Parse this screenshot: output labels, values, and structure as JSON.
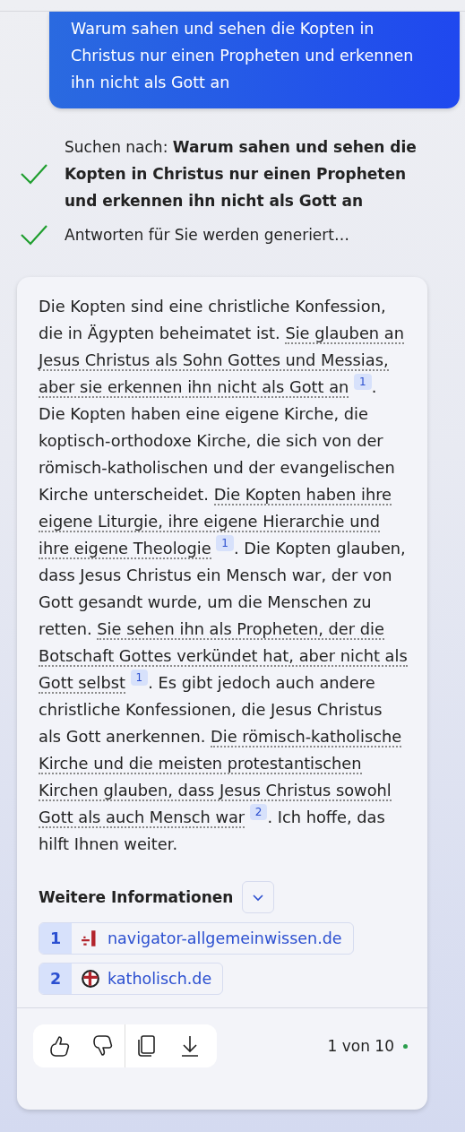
{
  "user_message": {
    "text": "Warum sahen und sehen die Kopten in Christus nur einen Propheten und erkennen ihn nicht als Gott an"
  },
  "steps": [
    {
      "kind": "check",
      "text": "Suchen nach: **Warum sahen und sehen die Kopten in Christus nur einen Propheten und erkennen ihn nicht als Gott an**"
    },
    {
      "kind": "check",
      "text": "Antworten für Sie werden generiert…"
    }
  ],
  "answer": {
    "segments": [
      {
        "kind": "plain",
        "text": "Die Kopten sind eine christliche Konfession, die in Ägypten beheimatet ist. "
      },
      {
        "kind": "cited",
        "text": "Sie glauben an Jesus Christus als Sohn Gottes und Messias, aber sie erkennen ihn nicht als Gott an",
        "ref": "1"
      },
      {
        "kind": "plain",
        "text": ". Die Kopten haben eine eigene Kirche, die koptisch-orthodoxe Kirche, die sich von der römisch-katholischen und der evangelischen Kirche unterscheidet. "
      },
      {
        "kind": "cited",
        "text": "Die Kopten haben ihre eigene Liturgie, ihre eigene Hierarchie und ihre eigene Theologie",
        "ref": "1"
      },
      {
        "kind": "plain",
        "text": ". Die Kopten glauben, dass Jesus Christus ein Mensch war, der von Gott gesandt wurde, um die Menschen zu retten. "
      },
      {
        "kind": "cited",
        "text": "Sie sehen ihn als Propheten, der die Botschaft Gottes verkündet hat, aber nicht als Gott selbst",
        "ref": "1"
      },
      {
        "kind": "plain",
        "text": ". Es gibt jedoch auch andere christliche Konfessionen, die Jesus Christus als Gott anerkennen. "
      },
      {
        "kind": "cited",
        "text": "Die römisch-katholische Kirche und die meisten protestantischen Kirchen glauben, dass Jesus Christus sowohl Gott als auch Mensch war",
        "ref": "2"
      },
      {
        "kind": "plain",
        "text": ". Ich hoffe, das hilft Ihnen weiter."
      }
    ],
    "more_info": {
      "label": "Weitere Informationen",
      "expanded": false
    },
    "sources": [
      {
        "number": "1",
        "kind": "navigator",
        "domain": "navigator-allgemeinwissen.de"
      },
      {
        "number": "2",
        "kind": "cross",
        "domain": "katholisch.de"
      }
    ],
    "actions": [
      {
        "kind": "thumbs-up"
      },
      {
        "kind": "thumbs-down"
      },
      {
        "kind": "copy"
      },
      {
        "kind": "download"
      }
    ],
    "counter": "1 von 10"
  }
}
